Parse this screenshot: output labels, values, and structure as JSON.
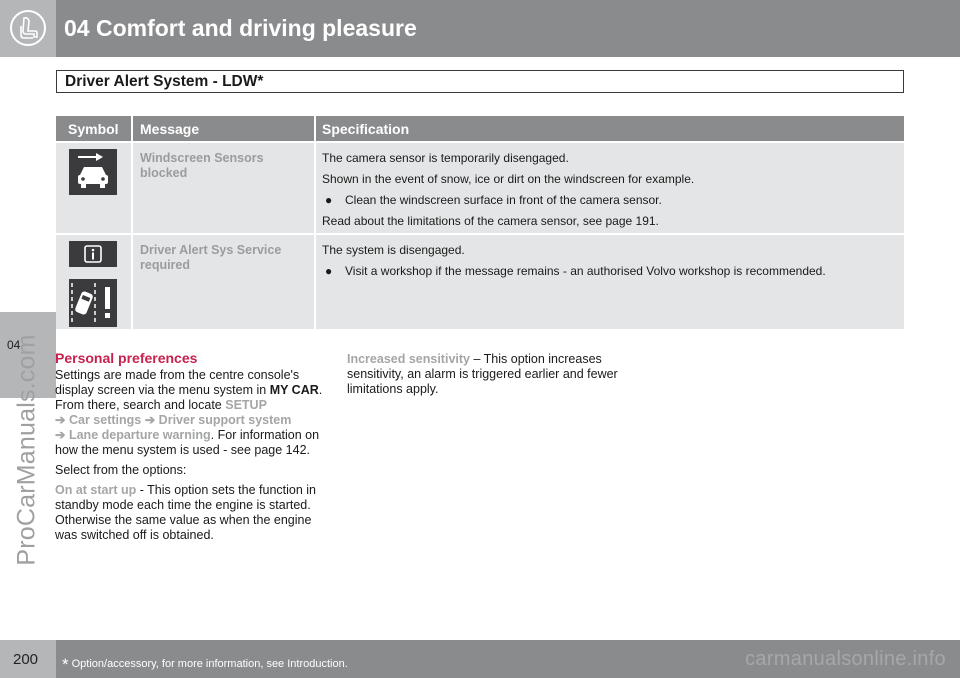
{
  "header": {
    "title": "04 Comfort and driving pleasure",
    "icon": "seat-icon"
  },
  "sidebar": {
    "chapter": "04",
    "watermark": "ProCarManuals.com"
  },
  "section": {
    "title": "Driver Alert System - LDW*"
  },
  "table": {
    "headers": [
      "Symbol",
      "Message",
      "Specification"
    ],
    "rows": [
      {
        "message": "Windscreen Sensors blocked",
        "symbol_icon": "camera-blocked-car-icon",
        "spec_lines": [
          "The camera sensor is temporarily disengaged.",
          "Shown in the event of snow, ice or dirt on the windscreen for example."
        ],
        "spec_bullet": "Clean the windscreen surface in front of the camera sensor.",
        "spec_footer": "Read about the limitations of the camera sensor, see page 191."
      },
      {
        "message": "Driver Alert Sys Service required",
        "symbol_icons": [
          "info-icon",
          "lane-warning-icon"
        ],
        "spec_lines": [
          "The system is disengaged."
        ],
        "spec_bullet": "Visit a workshop if the message remains - an authorised Volvo workshop is recommended."
      }
    ]
  },
  "personal": {
    "heading": "Personal preferences",
    "p1_a": "Settings are made from the centre console's display screen via the menu system in ",
    "p1_mycar": "MY CAR",
    "p1_b": ". From there, search and locate ",
    "p1_setup": "SETUP",
    "p1_car_settings": "Car settings",
    "p1_driver_support": "Driver support system",
    "p1_lane": "Lane departure warning",
    "p1_c": ". For information on how the menu system is used - see page 142.",
    "p2": "Select from the options:",
    "opt1_label": "On at start up",
    "opt1_text": " - This option sets the function in standby mode each time the engine is started. Otherwise the same value as when the engine was switched off is obtained.",
    "opt2_label": "Increased sensitivity",
    "opt2_text": " – This option increases sensitivity, an alarm is triggered earlier and fewer limitations apply."
  },
  "footer": {
    "page": "200",
    "star": "*",
    "note": "Option/accessory, for more information, see Introduction.",
    "watermark": "carmanualsonline.info"
  },
  "colors": {
    "header_gray": "#8a8b8d",
    "light_gray": "#b5b6b8",
    "row_bg": "#e4e5e6",
    "accent_red": "#c8214e",
    "highlight": "#a4a5a7"
  }
}
